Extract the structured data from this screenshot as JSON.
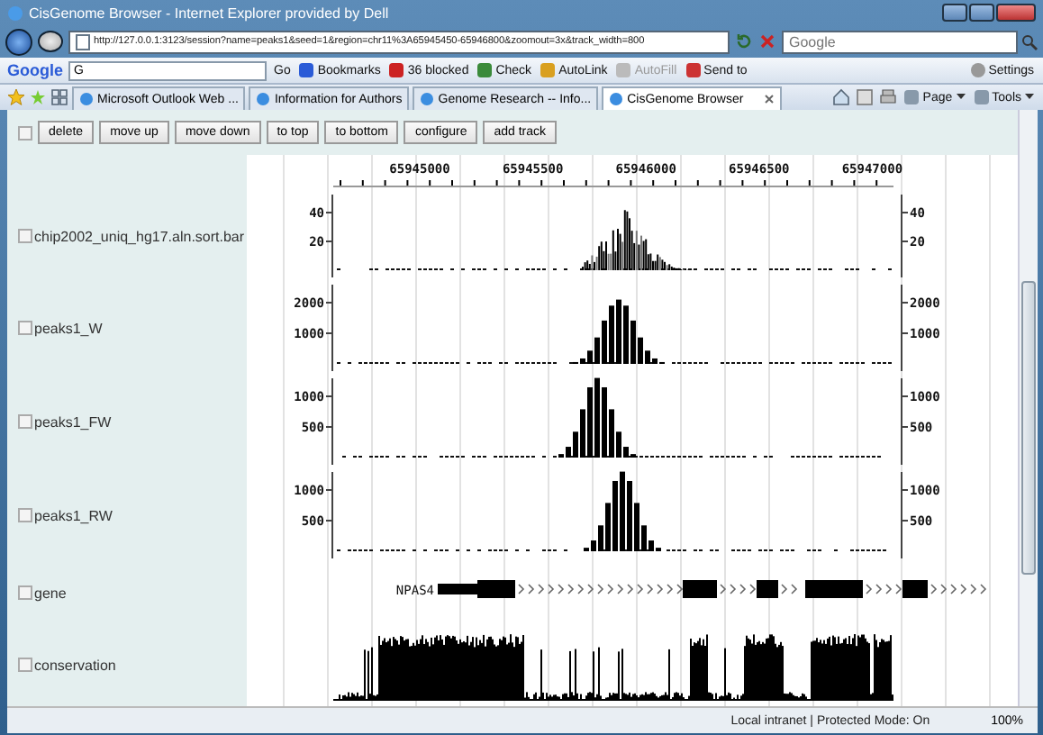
{
  "window": {
    "title": "CisGenome Browser - Internet Explorer provided by Dell"
  },
  "address_bar": {
    "url": "http://127.0.0.1:3123/session?name=peaks1&seed=1&region=chr11%3A65945450-65946800&zoomout=3x&track_width=800"
  },
  "search": {
    "placeholder": "Google"
  },
  "google_toolbar": {
    "logo": "Google",
    "search_label": "G",
    "items": [
      {
        "label": "Go",
        "disabled": false
      },
      {
        "label": "Bookmarks",
        "disabled": false
      },
      {
        "label": "36 blocked",
        "disabled": false
      },
      {
        "label": "Check",
        "disabled": false
      },
      {
        "label": "AutoLink",
        "disabled": false
      },
      {
        "label": "AutoFill",
        "disabled": true
      },
      {
        "label": "Send to",
        "disabled": false
      }
    ],
    "settings": "Settings"
  },
  "tabs": [
    {
      "label": "Microsoft Outlook Web ...",
      "selected": false
    },
    {
      "label": "Information for Authors",
      "selected": false
    },
    {
      "label": "Genome Research -- Info...",
      "selected": false
    },
    {
      "label": "CisGenome Browser",
      "selected": true
    }
  ],
  "command_bar": [
    "Page",
    "Tools"
  ],
  "toolbar": {
    "checked": false,
    "buttons": [
      "delete",
      "move up",
      "move down",
      "to top",
      "to bottom",
      "configure",
      "add track"
    ]
  },
  "ruler": {
    "labels": [
      "65945000",
      "65945500",
      "65946000",
      "65946500",
      "65947000"
    ]
  },
  "tracks": [
    {
      "kind": "signal",
      "name": "chip2002_uniq_hg17.aln.sort.bar",
      "checked": false,
      "left_ticks": [
        "40",
        "20"
      ],
      "right_ticks": [
        "40",
        "20"
      ]
    },
    {
      "kind": "signal",
      "name": "peaks1_W",
      "checked": false,
      "left_ticks": [
        "2000",
        "1000"
      ],
      "right_ticks": [
        "2000",
        "1000"
      ]
    },
    {
      "kind": "signal",
      "name": "peaks1_FW",
      "checked": false,
      "left_ticks": [
        "1000",
        "500"
      ],
      "right_ticks": [
        "1000",
        "500"
      ]
    },
    {
      "kind": "signal",
      "name": "peaks1_RW",
      "checked": false,
      "left_ticks": [
        "1000",
        "500"
      ],
      "right_ticks": [
        "1000",
        "500"
      ]
    },
    {
      "kind": "gene",
      "name": "gene",
      "checked": false,
      "gene_label": "NPAS4"
    },
    {
      "kind": "conservation",
      "name": "conservation",
      "checked": false
    }
  ],
  "status_bar": {
    "zone": "Local intranet | Protected Mode: On",
    "zoom": "100%"
  }
}
